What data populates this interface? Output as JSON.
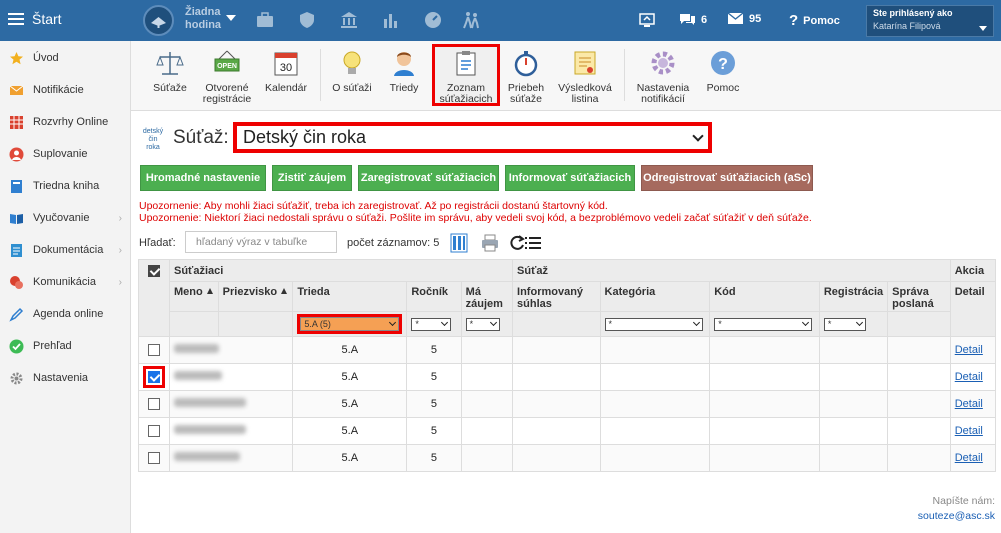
{
  "topbar": {
    "start_label": "Štart",
    "hour_label_1": "Žiadna",
    "hour_label_2": "hodina",
    "messages_count": "6",
    "mail_count": "95",
    "help_label": "Pomoc",
    "logged_as_label": "Ste prihlásený ako",
    "user_name": "Katarína Filipová",
    "bg_color": "#2d6aa3"
  },
  "sidebar": {
    "items": [
      {
        "label": "Úvod",
        "icon": "star-icon"
      },
      {
        "label": "Notifikácie",
        "icon": "mail-icon"
      },
      {
        "label": "Rozvrhy Online",
        "icon": "calendar-grid-icon"
      },
      {
        "label": "Suplovanie",
        "icon": "person-icon"
      },
      {
        "label": "Triedna kniha",
        "icon": "book-icon"
      },
      {
        "label": "Vyučovanie",
        "icon": "open-book-icon"
      },
      {
        "label": "Dokumentácia",
        "icon": "document-icon"
      },
      {
        "label": "Komunikácia",
        "icon": "chat-icon"
      },
      {
        "label": "Agenda online",
        "icon": "pen-icon"
      },
      {
        "label": "Prehľad",
        "icon": "check-circle-icon"
      },
      {
        "label": "Nastavenia",
        "icon": "gear-icon"
      }
    ]
  },
  "toolbar": {
    "items": [
      {
        "label_1": "Súťaže",
        "label_2": ""
      },
      {
        "label_1": "Otvorené",
        "label_2": "registrácie"
      },
      {
        "label_1": "Kalendár",
        "label_2": ""
      },
      {
        "label_1": "O súťaži",
        "label_2": ""
      },
      {
        "label_1": "Triedy",
        "label_2": ""
      },
      {
        "label_1": "Zoznam",
        "label_2": "súťažiacich"
      },
      {
        "label_1": "Priebeh",
        "label_2": "súťaže"
      },
      {
        "label_1": "Výsledková",
        "label_2": "listina"
      },
      {
        "label_1": "Nastavenia",
        "label_2": "notifikácií"
      },
      {
        "label_1": "Pomoc",
        "label_2": ""
      }
    ],
    "open_badge": "OPEN",
    "calendar_day": "30"
  },
  "contest": {
    "logo_text_1": "detský",
    "logo_text_2": "čin",
    "logo_text_3": "roka",
    "label": "Súťaž:",
    "selected": "Detský čin roka"
  },
  "actions": {
    "bulk_settings": "Hromadné nastavenie",
    "find_interest": "Zistiť záujem",
    "register": "Zaregistrovať súťažiacich",
    "inform": "Informovať súťažiacich",
    "unregister": "Odregistrovať súťažiacich (aSc)"
  },
  "warnings": {
    "w1": "Upozornenie: Aby mohli žiaci súťažiť, treba ich zaregistrovať. Až po registrácii dostanú štartovný kód.",
    "w2": "Upozornenie: Niektorí žiaci nedostali správu o súťaži. Pošlite im správu, aby vedeli svoj kód, a bezproblémovo vedeli začať súťažiť v deň súťaže."
  },
  "search": {
    "label": "Hľadať:",
    "placeholder": "hľadaný výraz v tabuľke",
    "count_label": "počet záznamov: 5"
  },
  "table": {
    "groups": {
      "competitors": "Súťažiaci",
      "competition": "Súťaž",
      "action": "Akcia"
    },
    "columns": {
      "name": "Meno",
      "surname": "Priezvisko",
      "class": "Trieda",
      "grade": "Ročník",
      "interest_1": "Má",
      "interest_2": "záujem",
      "consent_1": "Informovaný",
      "consent_2": "súhlas",
      "category": "Kategória",
      "code": "Kód",
      "registration": "Registrácia",
      "message_1": "Správa",
      "message_2": "poslaná",
      "detail": "Detail"
    },
    "filters": {
      "class": "5.A (5)",
      "interest": "*",
      "category": "*",
      "code": "*",
      "registration": "*",
      "grade": "*"
    },
    "rows": [
      {
        "checked": false,
        "class": "5.A",
        "grade": "5",
        "detail": "Detail"
      },
      {
        "checked": true,
        "class": "5.A",
        "grade": "5",
        "detail": "Detail"
      },
      {
        "checked": false,
        "class": "5.A",
        "grade": "5",
        "detail": "Detail"
      },
      {
        "checked": false,
        "class": "5.A",
        "grade": "5",
        "detail": "Detail"
      },
      {
        "checked": false,
        "class": "5.A",
        "grade": "5",
        "detail": "Detail"
      }
    ]
  },
  "footer": {
    "write_us": "Napíšte nám:",
    "email": "souteze@asc.sk"
  }
}
